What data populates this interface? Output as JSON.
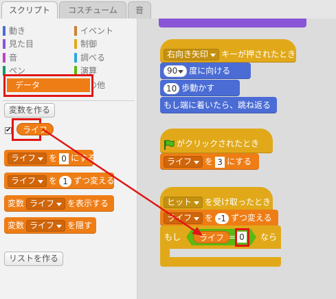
{
  "tabs": [
    "スクリプト",
    "コスチューム",
    "音"
  ],
  "categories": [
    {
      "label": "動き",
      "color": "#4a6cd4"
    },
    {
      "label": "イベント",
      "color": "#c88330"
    },
    {
      "label": "見た目",
      "color": "#8a55d7"
    },
    {
      "label": "制御",
      "color": "#e1a91a"
    },
    {
      "label": "音",
      "color": "#bb42c3"
    },
    {
      "label": "調べる",
      "color": "#2ca5e2"
    },
    {
      "label": "ペン",
      "color": "#0e9a6c"
    },
    {
      "label": "演算",
      "color": "#5cb712"
    },
    {
      "label": "データ",
      "color": "#ee7d16"
    },
    {
      "label": "その他",
      "color": "#632d99"
    }
  ],
  "palette": {
    "make_variable": "変数を作る",
    "variable_name": "ライフ",
    "set_block": {
      "var": "ライフ",
      "to": "を",
      "value": "0",
      "suffix": "にする"
    },
    "change_block": {
      "var": "ライフ",
      "by": "を",
      "value": "1",
      "suffix": "ずつ変える"
    },
    "show_block": {
      "prefix": "変数",
      "var": "ライフ",
      "suffix": "を表示する"
    },
    "hide_block": {
      "prefix": "変数",
      "var": "ライフ",
      "suffix": "を隠す"
    },
    "make_list": "リストを作る"
  },
  "script1": {
    "key": "右向き矢印",
    "hat_suffix": "キーが押されたとき",
    "point_value": "90",
    "point_suffix": "度に向ける",
    "move_value": "10",
    "move_suffix": "歩動かす",
    "bounce": "もし端に着いたら、跳ね返る"
  },
  "script2": {
    "hat_suffix": "がクリックされたとき",
    "set_var": "ライフ",
    "set_to": "を",
    "set_value": "3",
    "set_suffix": "にする"
  },
  "script3": {
    "message": "ヒット",
    "hat_suffix": "を受け取ったとき",
    "change_var": "ライフ",
    "change_by": "を",
    "change_value": "-1",
    "change_suffix": "ずつ変える",
    "if_label": "もし",
    "cond_var": "ライフ",
    "cond_op": "=",
    "cond_value": "0",
    "then_label": "なら"
  },
  "colors": {
    "annotation_red": "#e01616",
    "data_orange": "#ee7d16",
    "motion_blue": "#4a6cd4",
    "control_gold": "#e1a91a"
  }
}
